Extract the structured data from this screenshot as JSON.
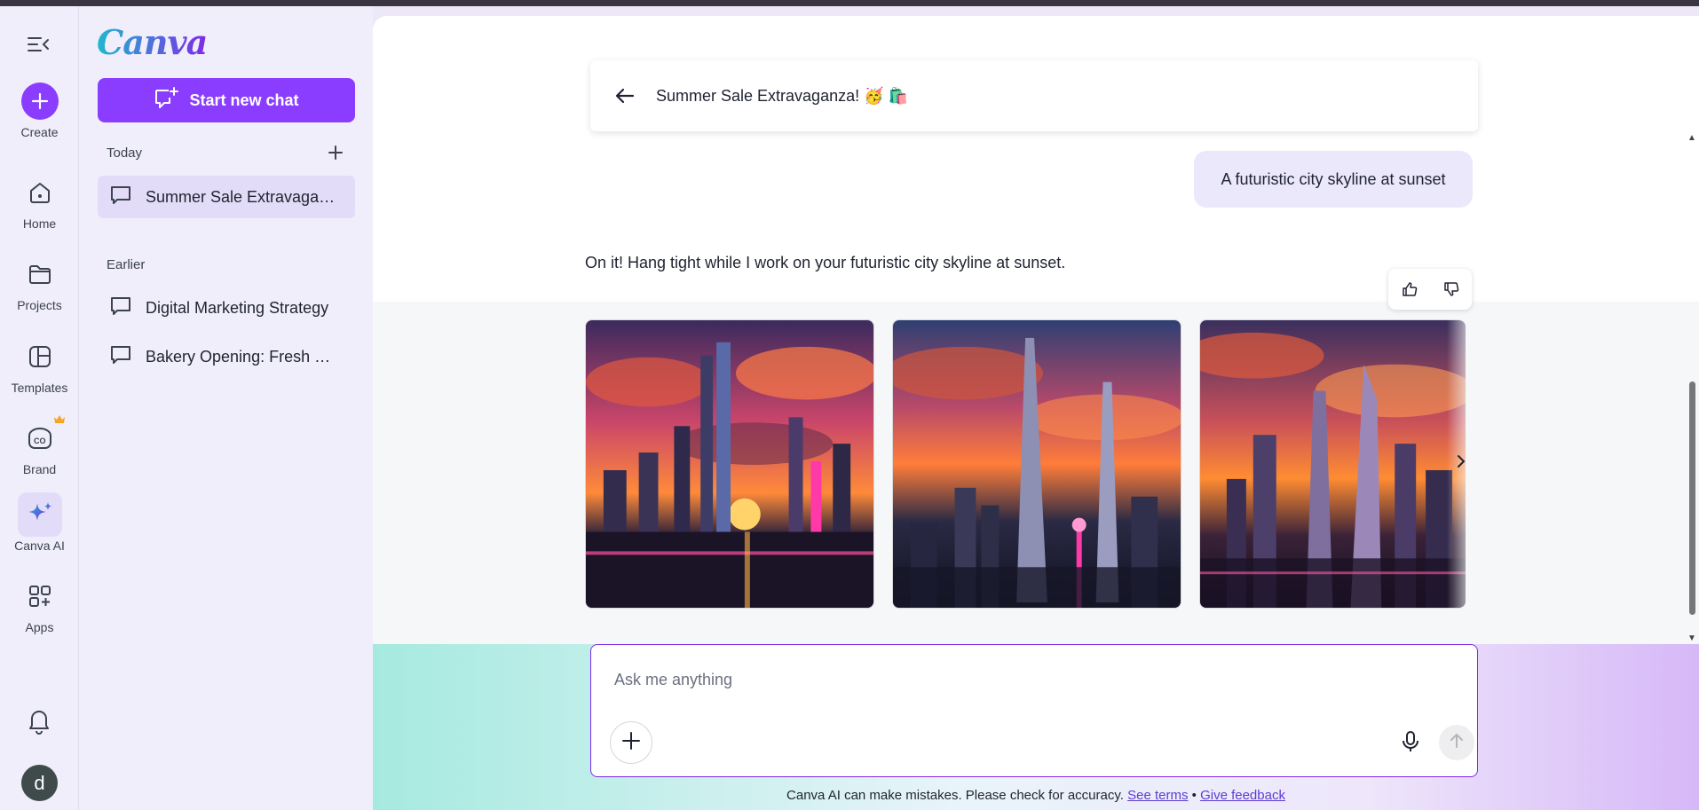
{
  "app": {
    "logo_text": "Canva"
  },
  "rail": {
    "create_label": "Create",
    "items": [
      {
        "label": "Home",
        "icon": "home-icon"
      },
      {
        "label": "Projects",
        "icon": "folder-icon"
      },
      {
        "label": "Templates",
        "icon": "templates-icon"
      },
      {
        "label": "Brand",
        "icon": "brand-icon"
      },
      {
        "label": "Canva AI",
        "icon": "sparkle-icon",
        "active": true
      },
      {
        "label": "Apps",
        "icon": "apps-icon"
      }
    ],
    "avatar_letter": "d"
  },
  "sidebar": {
    "new_chat_label": "Start new chat",
    "today_label": "Today",
    "today_items": [
      "Summer Sale Extravaganza! 🥳🛍️"
    ],
    "earlier_label": "Earlier",
    "earlier_items": [
      "Digital Marketing Strategy",
      "Bakery Opening: Fresh Bakes"
    ]
  },
  "chat": {
    "title": "Summer Sale Extravaganza! 🥳 🛍️",
    "user_message": "A futuristic city skyline at sunset",
    "ai_message": "On it! Hang tight while I work on your futuristic city skyline at sunset.",
    "images": [
      "futuristic-city-sunset-1",
      "futuristic-city-sunset-2",
      "futuristic-city-sunset-3"
    ]
  },
  "composer": {
    "placeholder": "Ask me anything"
  },
  "footer": {
    "disclaimer": "Canva AI can make mistakes. Please check for accuracy.",
    "terms_label": "See terms",
    "separator": "•",
    "feedback_label": "Give feedback"
  },
  "colors": {
    "brand_purple": "#8b3dff",
    "teal": "#1fb8cd",
    "sidebar_bg": "#f1eefb"
  }
}
